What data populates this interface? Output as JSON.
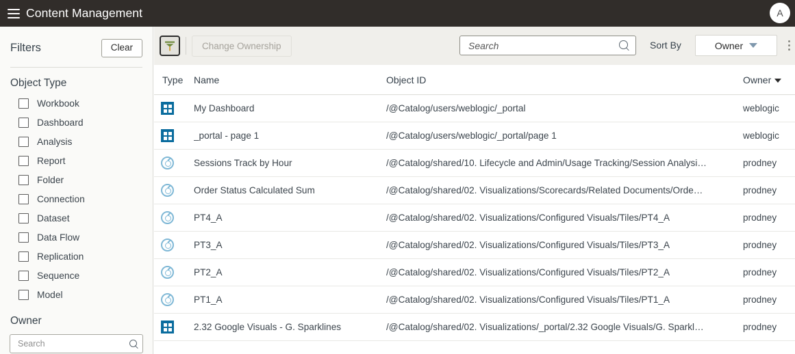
{
  "appbar": {
    "title": "Content Management",
    "menu_icon": "hamburger-icon",
    "avatar_initial": "A"
  },
  "sidebar": {
    "title": "Filters",
    "clear_label": "Clear",
    "object_type": {
      "title": "Object Type",
      "items": [
        {
          "label": "Workbook",
          "checked": false
        },
        {
          "label": "Dashboard",
          "checked": false
        },
        {
          "label": "Analysis",
          "checked": false
        },
        {
          "label": "Report",
          "checked": false
        },
        {
          "label": "Folder",
          "checked": false
        },
        {
          "label": "Connection",
          "checked": false
        },
        {
          "label": "Dataset",
          "checked": false
        },
        {
          "label": "Data Flow",
          "checked": false
        },
        {
          "label": "Replication",
          "checked": false
        },
        {
          "label": "Sequence",
          "checked": false
        },
        {
          "label": "Model",
          "checked": false
        }
      ]
    },
    "owner": {
      "title": "Owner",
      "search_placeholder": "Search",
      "search_value": ""
    }
  },
  "toolbar": {
    "filter_toggle_icon": "funnel-icon",
    "change_ownership_label": "Change Ownership",
    "change_ownership_disabled": true,
    "search_placeholder": "Search",
    "search_value": "",
    "sort_by_label": "Sort By",
    "sort_by_value": "Owner",
    "more_options_icon": "kebab-menu-icon"
  },
  "table": {
    "columns": [
      "Type",
      "Name",
      "Object ID",
      "Owner"
    ],
    "sorted_column": "Owner",
    "rows": [
      {
        "icon": "dashboard-icon",
        "name": "My Dashboard",
        "object_id": "/@Catalog/users/weblogic/_portal",
        "owner": "weblogic"
      },
      {
        "icon": "dashboard-icon",
        "name": "_portal - page 1",
        "object_id": "/@Catalog/users/weblogic/_portal/page 1",
        "owner": "weblogic"
      },
      {
        "icon": "analysis-icon",
        "name": "Sessions Track by Hour",
        "object_id": "/@Catalog/shared/10. Lifecycle and Admin/Usage Tracking/Session Analysi…",
        "owner": "prodney"
      },
      {
        "icon": "analysis-icon",
        "name": "Order Status Calculated Sum",
        "object_id": "/@Catalog/shared/02. Visualizations/Scorecards/Related Documents/Orde…",
        "owner": "prodney"
      },
      {
        "icon": "analysis-icon",
        "name": "PT4_A",
        "object_id": "/@Catalog/shared/02. Visualizations/Configured Visuals/Tiles/PT4_A",
        "owner": "prodney"
      },
      {
        "icon": "analysis-icon",
        "name": "PT3_A",
        "object_id": "/@Catalog/shared/02. Visualizations/Configured Visuals/Tiles/PT3_A",
        "owner": "prodney"
      },
      {
        "icon": "analysis-icon",
        "name": "PT2_A",
        "object_id": "/@Catalog/shared/02. Visualizations/Configured Visuals/Tiles/PT2_A",
        "owner": "prodney"
      },
      {
        "icon": "analysis-icon",
        "name": "PT1_A",
        "object_id": "/@Catalog/shared/02. Visualizations/Configured Visuals/Tiles/PT1_A",
        "owner": "prodney"
      },
      {
        "icon": "dashboard-icon",
        "name": "2.32 Google Visuals - G. Sparklines",
        "object_id": "/@Catalog/shared/02. Visualizations/_portal/2.32 Google Visuals/G. Sparkl…",
        "owner": "prodney"
      }
    ]
  },
  "colors": {
    "appbar_bg": "#312d2a",
    "sidebar_bg": "#fafaf8",
    "toolbar_bg": "#f0efeb",
    "dashboard_icon": "#0a6c9e",
    "analysis_icon": "#7fb8d6",
    "funnel_top": "#6f8a3c",
    "funnel_stem": "#d1a33a"
  }
}
